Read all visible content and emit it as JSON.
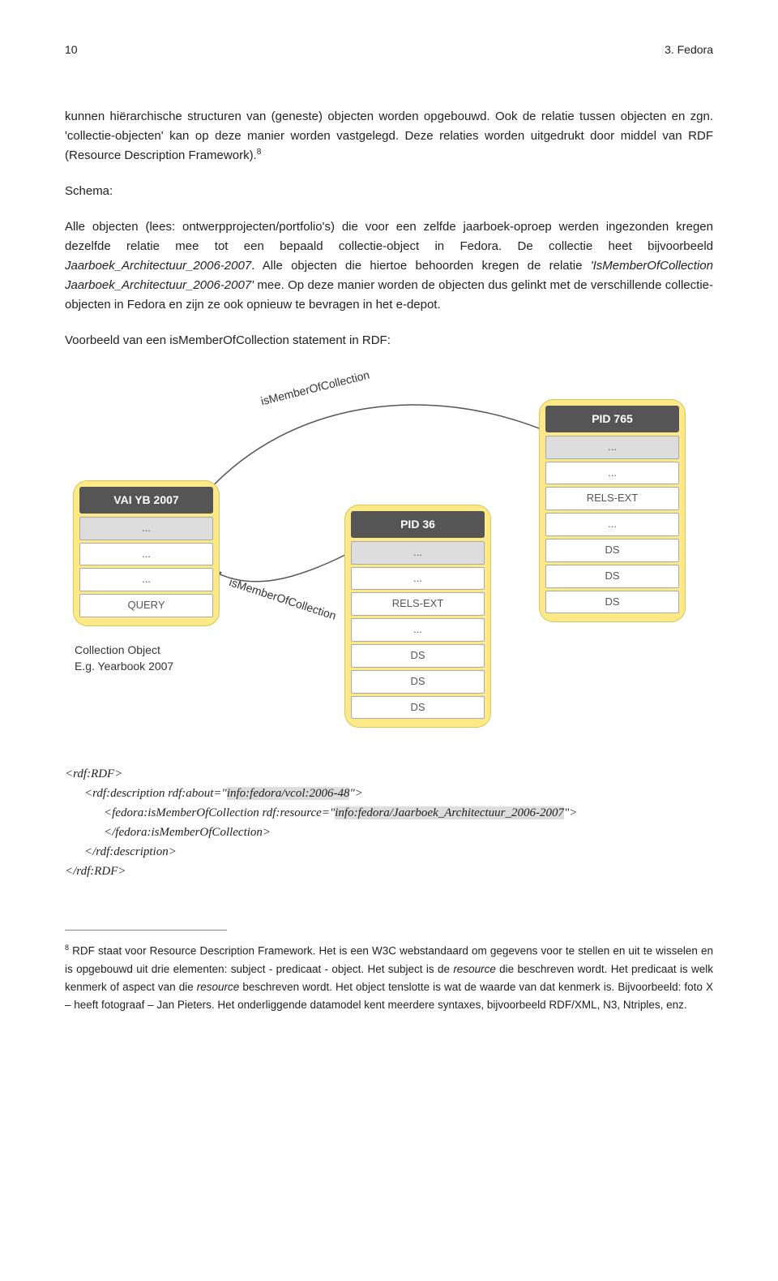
{
  "header": {
    "page_number": "10",
    "section": "3. Fedora"
  },
  "paragraphs": {
    "p1_a": "kunnen hiërarchische structuren van (geneste) objecten worden opgebouwd. Ook de relatie tussen objecten en zgn. 'collectie-objecten' kan op deze manier worden vastgelegd. Deze relaties worden uitgedrukt door middel van RDF (Resource Description Framework).",
    "p1_sup": "8",
    "schema_label": "Schema:",
    "p2_a": "Alle objecten (lees: ontwerpprojecten/portfolio's) die voor een zelfde jaarboek-oproep werden ingezonden kregen dezelfde relatie mee tot een bepaald collectie-object in Fedora. De collectie heet bijvoorbeeld ",
    "p2_it1": "Jaarboek_Architectuur_2006-2007",
    "p2_b": ". Alle objecten die hiertoe behoorden kregen de relatie ",
    "p2_it2": "'IsMemberOfCollection Jaarboek_Architectuur_2006-2007'",
    "p2_c": " mee. Op deze manier worden de objecten dus gelinkt met de verschillende collectie-objecten in Fedora en zijn ze ook opnieuw te bevragen in het e-depot.",
    "example_label": "Voorbeeld van een isMemberOfCollection statement in RDF:"
  },
  "diagram": {
    "card_left": {
      "title": "VAI YB 2007",
      "rows": [
        "...",
        "...",
        "...",
        "QUERY"
      ]
    },
    "card_mid": {
      "title": "PID 36",
      "rows": [
        "...",
        "...",
        "RELS-EXT",
        "...",
        "DS",
        "DS",
        "DS"
      ]
    },
    "card_right": {
      "title": "PID 765",
      "rows": [
        "...",
        "...",
        "RELS-EXT",
        "...",
        "DS",
        "DS",
        "DS"
      ]
    },
    "edge_label_top": "isMemberOfCollection",
    "edge_label_bottom": "isMemberOfCollection",
    "caption_line1": "Collection Object",
    "caption_line2": "E.g. Yearbook 2007"
  },
  "rdf": {
    "l1": "<rdf:RDF>",
    "l2a": "<rdf:description rdf:about=\"",
    "l2hl": "info:fedora/vcol:2006-48",
    "l2b": "\">",
    "l3a": "<fedora:isMemberOfCollection rdf:resource=\"",
    "l3hl": "info:fedora/Jaarboek_Architectuur_2006-2007",
    "l3b": "\">",
    "l4": "</fedora:isMemberOfCollection>",
    "l5": "</rdf:description>",
    "l6": "</rdf:RDF>"
  },
  "footnote": {
    "num": "8",
    "text_a": " RDF staat voor Resource Description Framework. Het is een W3C webstandaard om gegevens voor te stellen en uit te wisselen en is opgebouwd uit drie elementen: subject - predicaat - object. Het subject is de ",
    "text_it1": "resource ",
    "text_b": "die beschreven wordt. Het predicaat is welk kenmerk of aspect van die ",
    "text_it2": "resource",
    "text_c": " beschreven wordt. Het object tenslotte is wat de waarde van dat kenmerk is. Bijvoorbeeld: foto X – heeft fotograaf – Jan Pieters. Het onderliggende datamodel kent meerdere syntaxes, bijvoorbeeld RDF/XML, N3, Ntriples, enz."
  }
}
